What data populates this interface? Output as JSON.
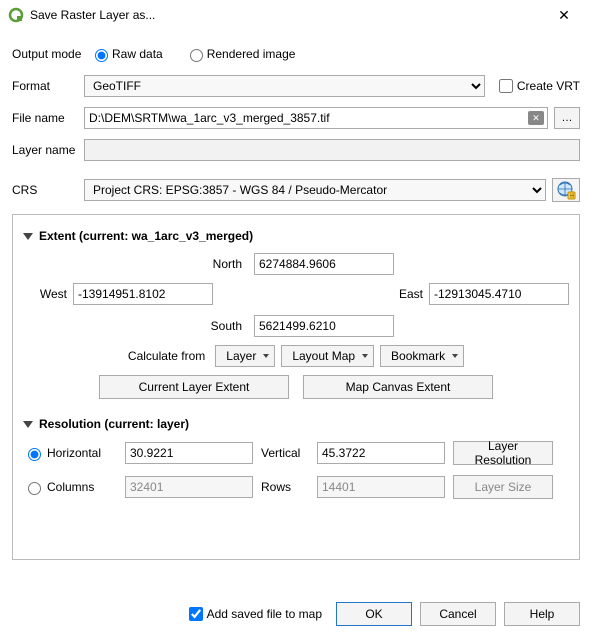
{
  "titlebar": {
    "title": "Save Raster Layer as..."
  },
  "output_mode": {
    "label": "Output mode",
    "raw": "Raw data",
    "rendered": "Rendered image",
    "selected": "raw"
  },
  "format": {
    "label": "Format",
    "value": "GeoTIFF",
    "create_vrt": "Create VRT"
  },
  "filename": {
    "label": "File name",
    "value": "D:\\DEM\\SRTM\\wa_1arc_v3_merged_3857.tif",
    "browse": "…"
  },
  "layername": {
    "label": "Layer name",
    "value": ""
  },
  "crs": {
    "label": "CRS",
    "value": "Project CRS: EPSG:3857 - WGS 84 / Pseudo-Mercator"
  },
  "extent": {
    "header": "Extent (current: wa_1arc_v3_merged)",
    "north_label": "North",
    "north": "6274884.9606",
    "west_label": "West",
    "west": "-13914951.8102",
    "east_label": "East",
    "east": "-12913045.4710",
    "south_label": "South",
    "south": "5621499.6210",
    "calc_from": "Calculate from",
    "layer_btn": "Layer",
    "layoutmap_btn": "Layout Map",
    "bookmark_btn": "Bookmark",
    "cur_layer_extent": "Current Layer Extent",
    "map_canvas_extent": "Map Canvas Extent"
  },
  "resolution": {
    "header": "Resolution (current: layer)",
    "horiz_label": "Horizontal",
    "horiz": "30.9221",
    "vert_label": "Vertical",
    "vert": "45.3722",
    "layer_res_btn": "Layer Resolution",
    "cols_label": "Columns",
    "cols": "32401",
    "rows_label": "Rows",
    "rows": "14401",
    "layer_size_btn": "Layer Size"
  },
  "bottom": {
    "add_saved": "Add saved file to map",
    "ok": "OK",
    "cancel": "Cancel",
    "help": "Help"
  }
}
